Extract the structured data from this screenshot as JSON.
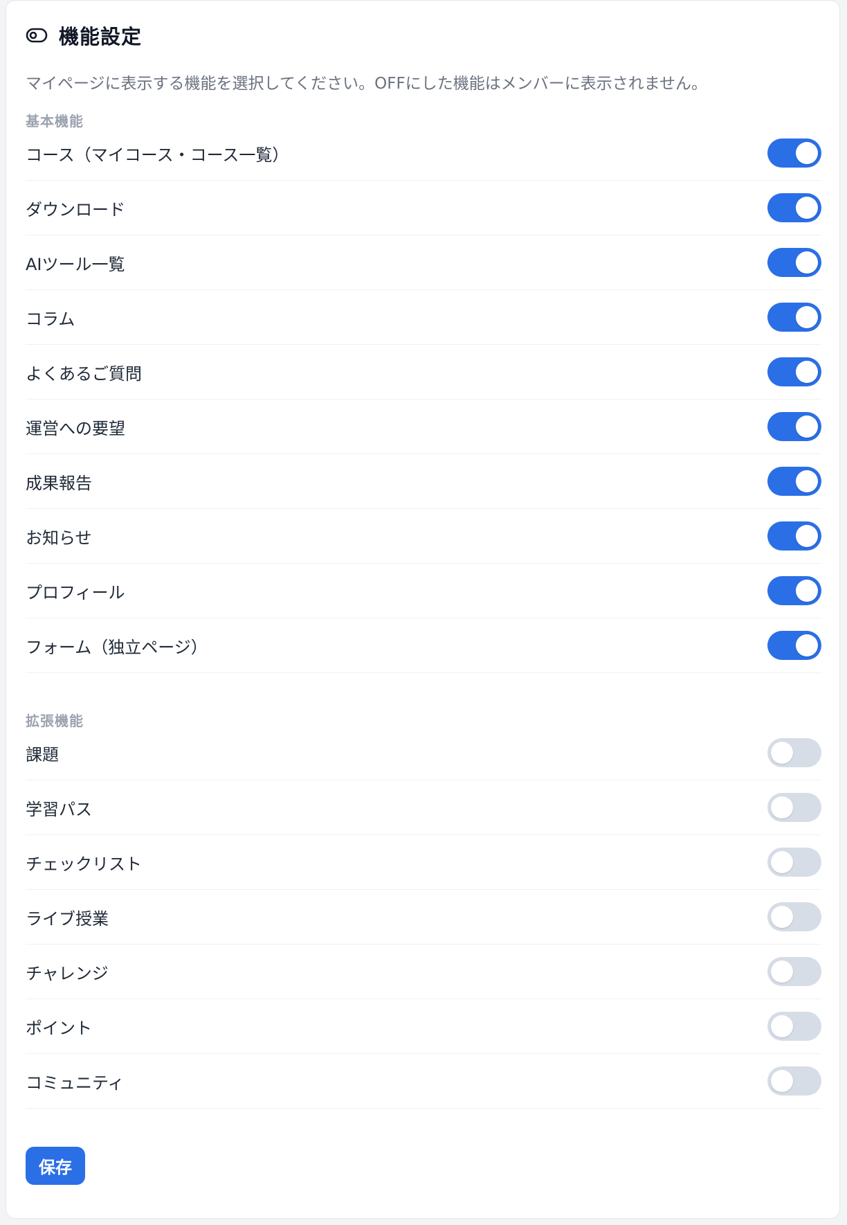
{
  "header": {
    "icon": "eye-icon",
    "title": "機能設定",
    "description": "マイページに表示する機能を選択してください。OFFにした機能はメンバーに表示されません。"
  },
  "sections": {
    "basic": {
      "title": "基本機能",
      "items": [
        {
          "label": "コース（マイコース・コース一覧）",
          "enabled": true
        },
        {
          "label": "ダウンロード",
          "enabled": true
        },
        {
          "label": "AIツール一覧",
          "enabled": true
        },
        {
          "label": "コラム",
          "enabled": true
        },
        {
          "label": "よくあるご質問",
          "enabled": true
        },
        {
          "label": "運営への要望",
          "enabled": true
        },
        {
          "label": "成果報告",
          "enabled": true
        },
        {
          "label": "お知らせ",
          "enabled": true
        },
        {
          "label": "プロフィール",
          "enabled": true
        },
        {
          "label": "フォーム（独立ページ）",
          "enabled": true
        }
      ]
    },
    "extended": {
      "title": "拡張機能",
      "items": [
        {
          "label": "課題",
          "enabled": false
        },
        {
          "label": "学習パス",
          "enabled": false
        },
        {
          "label": "チェックリスト",
          "enabled": false
        },
        {
          "label": "ライブ授業",
          "enabled": false
        },
        {
          "label": "チャレンジ",
          "enabled": false
        },
        {
          "label": "ポイント",
          "enabled": false
        },
        {
          "label": "コミュニティ",
          "enabled": false
        }
      ]
    }
  },
  "actions": {
    "save_label": "保存"
  },
  "colors": {
    "accent": "#2b6fe6",
    "toggle_off": "#d6dde6",
    "section_title": "#9ca3af",
    "description": "#6b7280"
  }
}
